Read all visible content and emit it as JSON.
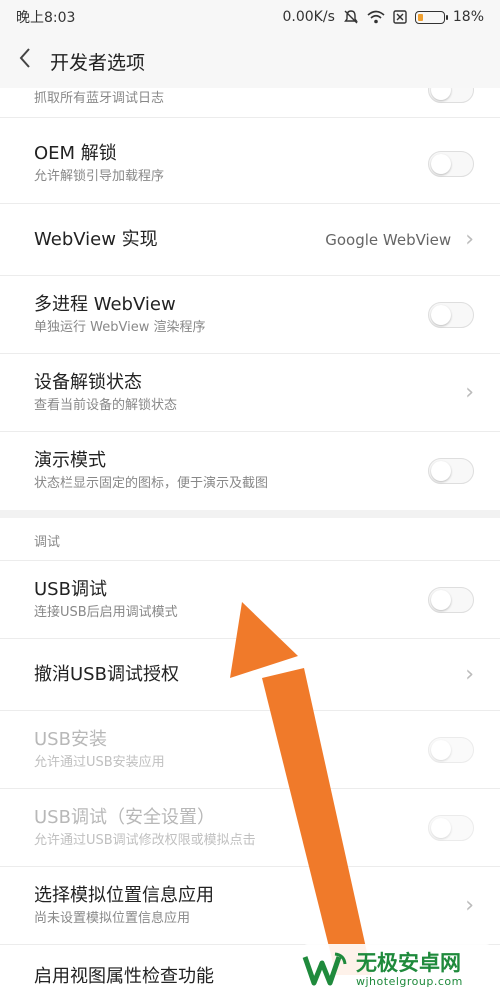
{
  "status": {
    "time": "晚上8:03",
    "speed": "0.00K/s",
    "battery": "18%",
    "icons": [
      "mute-icon",
      "wifi-icon",
      "no-sim-icon",
      "battery-icon"
    ]
  },
  "header": {
    "title": "开发者选项",
    "back_icon": "back-arrow-icon"
  },
  "items": {
    "bt_log": {
      "subtitle": "抓取所有蓝牙调试日志"
    },
    "oem": {
      "title": "OEM 解锁",
      "subtitle": "允许解锁引导加载程序",
      "toggle": "off"
    },
    "webview_impl": {
      "title": "WebView 实现",
      "value": "Google WebView"
    },
    "multi_webview": {
      "title": "多进程 WebView",
      "subtitle": "单独运行 WebView 渲染程序",
      "toggle": "off"
    },
    "unlock_state": {
      "title": "设备解锁状态",
      "subtitle": "查看当前设备的解锁状态"
    },
    "demo_mode": {
      "title": "演示模式",
      "subtitle": "状态栏显示固定的图标，便于演示及截图",
      "toggle": "off"
    },
    "section_debug": "调试",
    "usb_debug": {
      "title": "USB调试",
      "subtitle": "连接USB后启用调试模式",
      "toggle": "off"
    },
    "revoke_usb": {
      "title": "撤消USB调试授权"
    },
    "usb_install": {
      "title": "USB安装",
      "subtitle": "允许通过USB安装应用",
      "toggle": "off",
      "enabled": false
    },
    "usb_debug_secure": {
      "title": "USB调试（安全设置）",
      "subtitle": "允许通过USB调试修改权限或模拟点击",
      "toggle": "off",
      "enabled": false
    },
    "mock_location": {
      "title": "选择模拟位置信息应用",
      "subtitle": "尚未设置模拟位置信息应用"
    },
    "view_attr": {
      "title": "启用视图属性检查功能"
    }
  },
  "annotation": {
    "color": "#f07a2a"
  },
  "watermark": {
    "name": "无极安卓网",
    "url": "wjhotelgroup.com",
    "logo_color": "#1f8a3c"
  }
}
